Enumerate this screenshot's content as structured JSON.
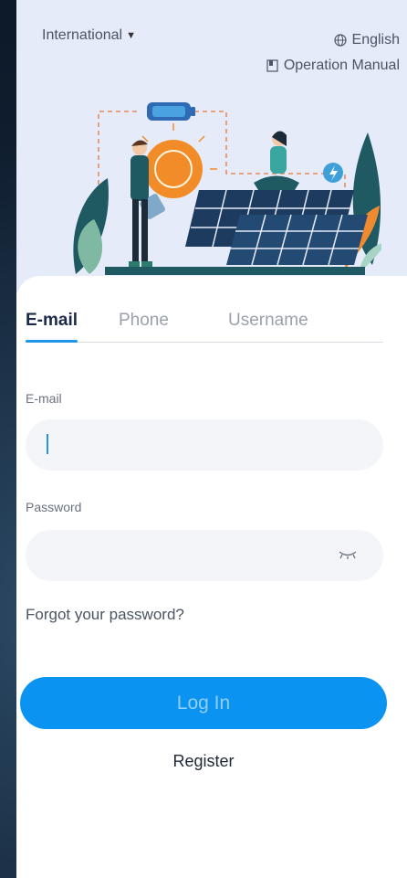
{
  "header": {
    "region_label": "International",
    "language_label": "English",
    "manual_label": "Operation Manual"
  },
  "tabs": [
    {
      "label": "E-mail",
      "active": true
    },
    {
      "label": "Phone",
      "active": false
    },
    {
      "label": "Username",
      "active": false
    }
  ],
  "form": {
    "email_label": "E-mail",
    "email_value": "",
    "password_label": "Password",
    "password_value": "",
    "forgot_label": "Forgot your password?",
    "login_label": "Log In",
    "register_label": "Register"
  },
  "colors": {
    "accent": "#1e95e8",
    "button": "#0b93f2",
    "hero_bg": "#e6ebfa"
  },
  "icons": [
    "caret-down-icon",
    "globe-icon",
    "book-icon",
    "eye-closed-icon"
  ]
}
